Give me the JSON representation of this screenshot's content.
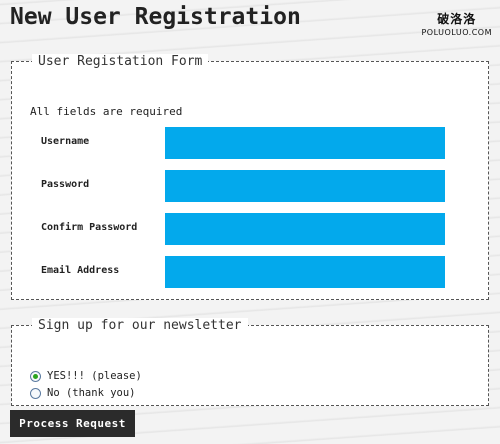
{
  "page": {
    "title": "New User Registration"
  },
  "watermark": {
    "cn": "破洛洛",
    "en": "POLUOLUO.COM"
  },
  "registration": {
    "legend": "User Registation Form",
    "note": "All fields are required",
    "fields": [
      {
        "label": "Username",
        "value": ""
      },
      {
        "label": "Password",
        "value": ""
      },
      {
        "label": "Confirm Password",
        "value": ""
      },
      {
        "label": "Email Address",
        "value": ""
      }
    ]
  },
  "newsletter": {
    "legend": "Sign up for our newsletter",
    "options": [
      {
        "label": "YES!!! (please)",
        "selected": true
      },
      {
        "label": "No (thank you)",
        "selected": false
      }
    ]
  },
  "submit_label": "Process Request",
  "colors": {
    "field_fill": "#03a9ec",
    "button": "#2b2b2b",
    "radio_dot": "#2aa51f"
  }
}
